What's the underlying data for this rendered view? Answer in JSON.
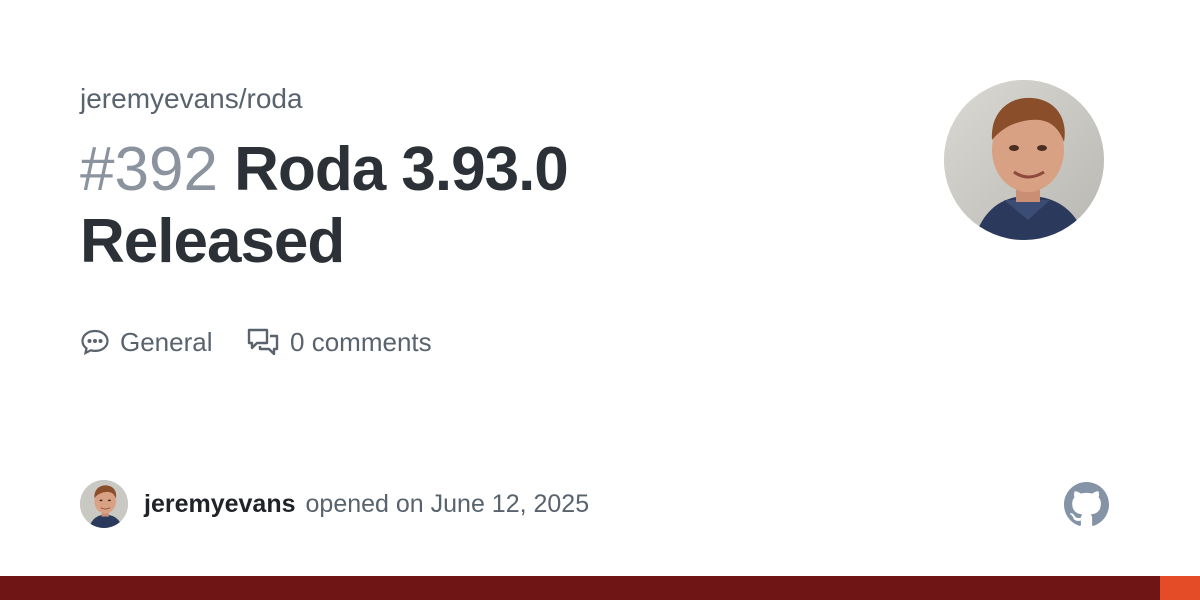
{
  "repo": {
    "full_name": "jeremyevans/roda"
  },
  "discussion": {
    "number": "#392",
    "title": "Roda 3.93.0 Released",
    "category_icon": "speech-bubble-icon",
    "category": "General",
    "comments_icon": "comment-discussion-icon",
    "comments_count": "0",
    "comments_label": "comments"
  },
  "author": {
    "username": "jeremyevans",
    "opened_text": "opened on June 12, 2025",
    "avatar": "author-avatar"
  },
  "branding": {
    "logo_icon": "github-icon",
    "language_bar_colors": [
      "#701516",
      "#e34c26"
    ]
  }
}
